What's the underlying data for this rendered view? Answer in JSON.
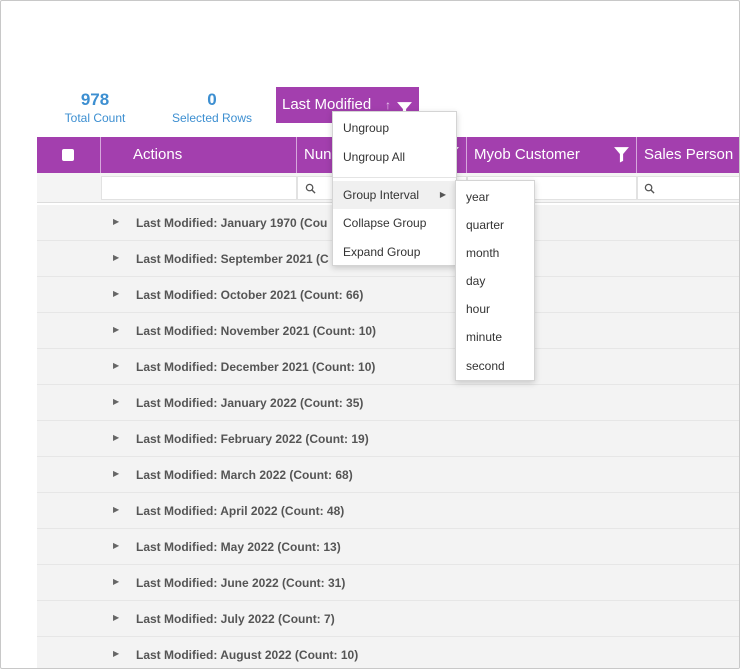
{
  "stats": {
    "total": {
      "value": "978",
      "label": "Total Count"
    },
    "selected": {
      "value": "0",
      "label": "Selected Rows"
    }
  },
  "group_chip": {
    "label": "Last Modified",
    "sort_indicator": "↑"
  },
  "columns": {
    "actions": "Actions",
    "number": "Nun",
    "myob_customer": "Myob Customer",
    "sales_person": "Sales Person"
  },
  "context_menu": {
    "items": [
      "Ungroup",
      "Ungroup All",
      "Group Interval",
      "Collapse Group",
      "Expand Group"
    ]
  },
  "sub_menu": {
    "items": [
      "year",
      "quarter",
      "month",
      "day",
      "hour",
      "minute",
      "second"
    ]
  },
  "group_rows": [
    "Last Modified: January 1970 (Cou",
    "Last Modified: September 2021 (C",
    "Last Modified: October 2021 (Count: 66)",
    "Last Modified: November 2021 (Count: 10)",
    "Last Modified: December 2021 (Count: 10)",
    "Last Modified: January 2022 (Count: 35)",
    "Last Modified: February 2022 (Count: 19)",
    "Last Modified: March 2022 (Count: 68)",
    "Last Modified: April 2022 (Count: 48)",
    "Last Modified: May 2022 (Count: 13)",
    "Last Modified: June 2022 (Count: 31)",
    "Last Modified: July 2022 (Count: 7)",
    "Last Modified: August 2022 (Count: 10)"
  ],
  "colors": {
    "header": "#a33fae",
    "accent": "#3d8fd1"
  },
  "icons": {
    "filter": "filter-icon",
    "search": "search-icon",
    "caret": "caret-right-icon"
  }
}
